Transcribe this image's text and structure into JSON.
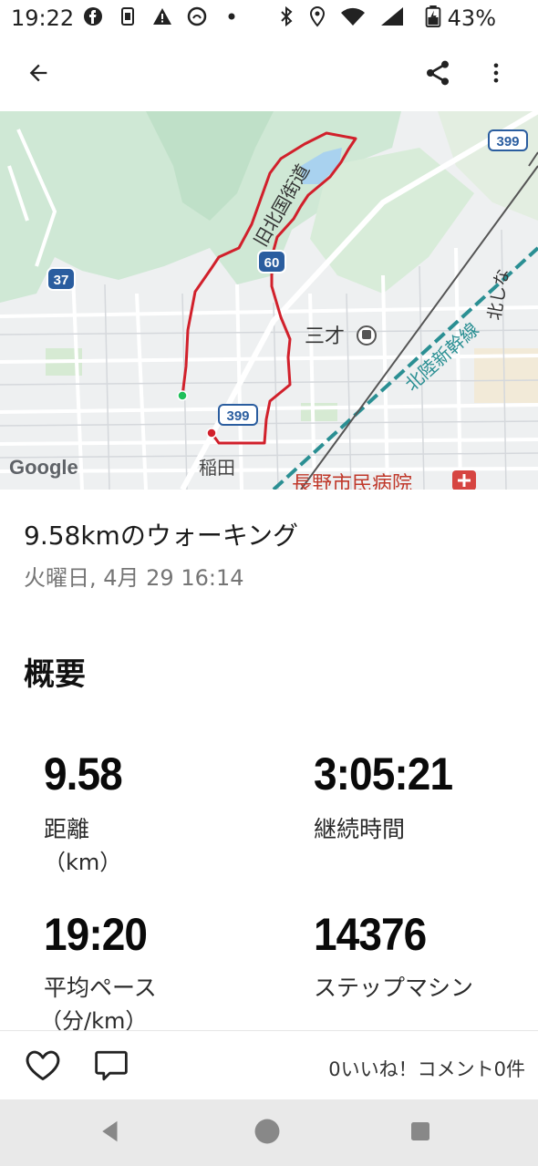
{
  "status_bar": {
    "time": "19:22",
    "battery": "43%",
    "icons": [
      "facebook-icon",
      "sim-icon",
      "warning-icon",
      "notification-icon",
      "dot-icon",
      "bluetooth-icon",
      "location-icon",
      "wifi-icon",
      "signal-icon",
      "battery-icon"
    ]
  },
  "app_bar": {
    "back_icon": "arrow-back-icon",
    "share_icon": "share-icon",
    "more_icon": "more-vert-icon"
  },
  "map": {
    "labels": {
      "route399_top": "399",
      "kitakaido": "旧北国街道",
      "kitashinano": "北しな",
      "route37": "37",
      "route60": "60",
      "sansai": "三才",
      "hokuriku": "北陸新幹線",
      "route399_bottom": "399",
      "inada": "稲田",
      "hospital": "長野市民病院",
      "google": "Google"
    },
    "colors": {
      "route": "#d1202b",
      "start": "#1fbf5a",
      "end": "#d1202b",
      "rail": "#2a8f93"
    }
  },
  "activity": {
    "title": "9.58kmのウォーキング",
    "datetime": "火曜日, 4月 29 16:14"
  },
  "summary": {
    "title": "概要",
    "stats": [
      {
        "value": "9.58",
        "label": "距離",
        "unit": "（km）"
      },
      {
        "value": "3:05:21",
        "label": "継続時間",
        "unit": ""
      },
      {
        "value": "19:20",
        "label": "平均ペース",
        "unit": "（分/km）"
      },
      {
        "value": "14376",
        "label": "ステップマシン",
        "unit": ""
      }
    ]
  },
  "actions": {
    "like_icon": "heart-icon",
    "comment_icon": "comment-icon",
    "social_text": "0いいね！コメント0件"
  },
  "nav": {
    "back": "nav-back-icon",
    "home": "nav-home-icon",
    "recents": "nav-recents-icon"
  }
}
